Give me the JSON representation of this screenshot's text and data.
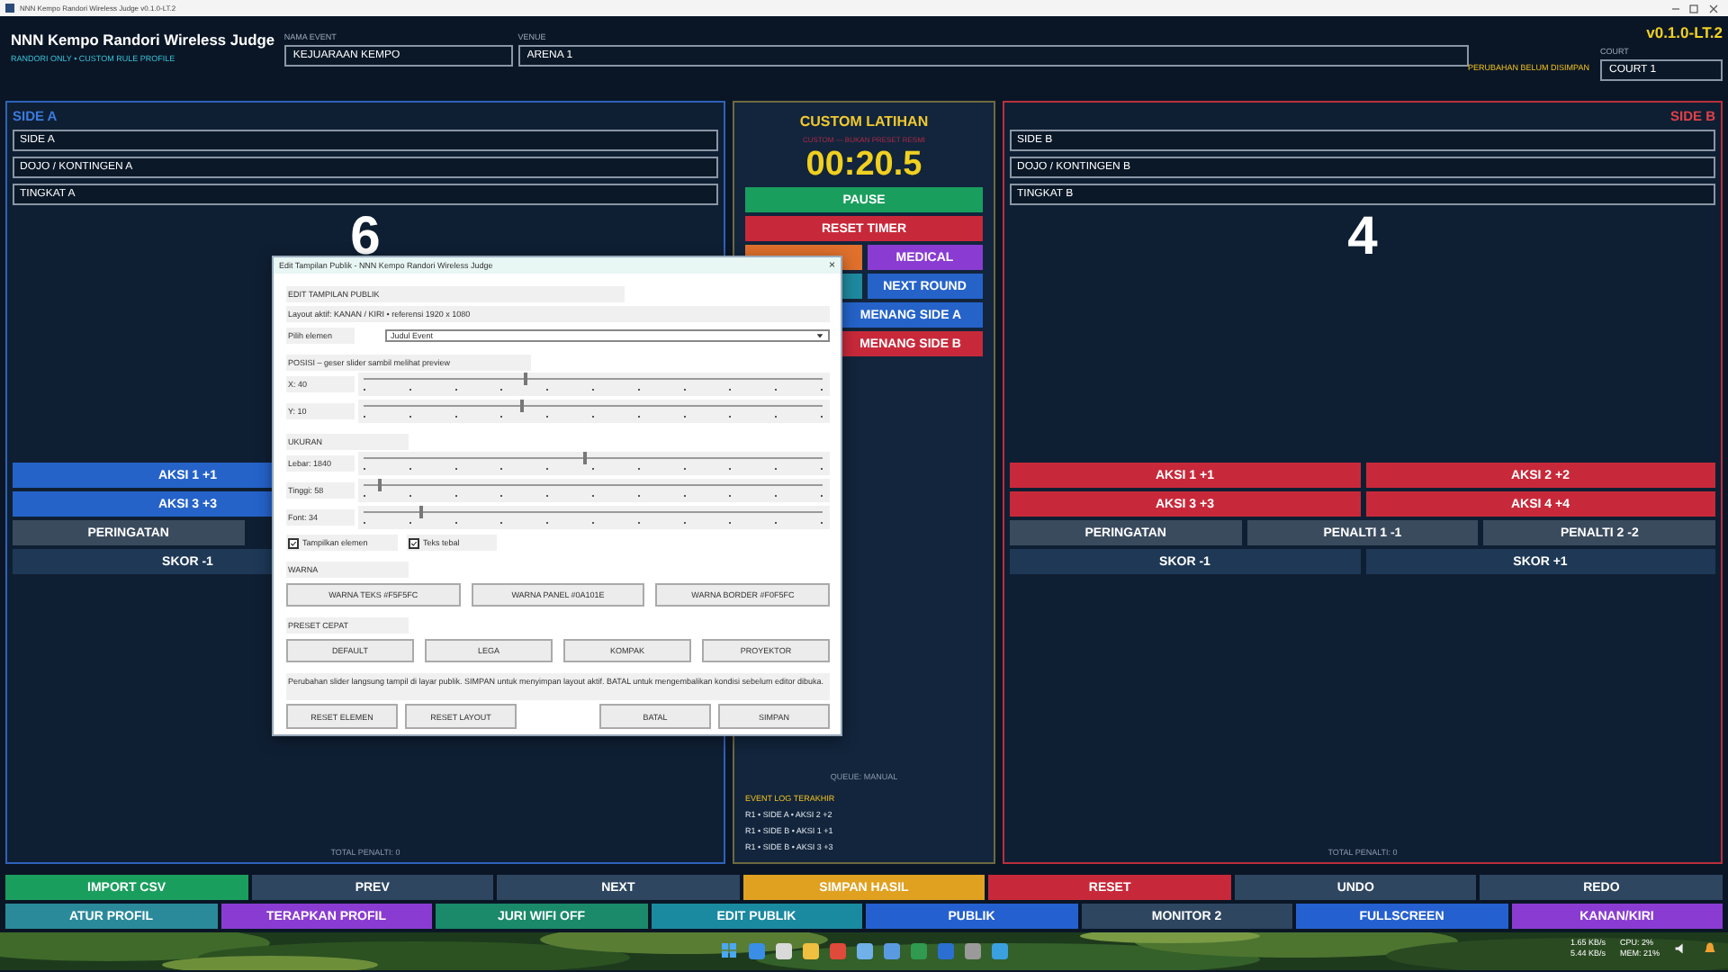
{
  "window": {
    "title": "NNN Kempo Randori Wireless Judge v0.1.0-LT.2"
  },
  "header": {
    "title": "NNN Kempo Randori Wireless Judge",
    "subtitle": "RANDORI ONLY • CUSTOM RULE PROFILE",
    "version": "v0.1.0-LT.2",
    "unsaved_notice": "PERUBAHAN BELUM DISIMPAN",
    "event_name": {
      "label": "NAMA EVENT",
      "value": "KEJUARAAN KEMPO"
    },
    "venue": {
      "label": "VENUE",
      "value": "ARENA 1"
    },
    "court": {
      "label": "COURT",
      "value": "COURT 1"
    }
  },
  "side_a": {
    "heading": "SIDE A",
    "fields": [
      "SIDE A",
      "DOJO / KONTINGEN A",
      "TINGKAT A"
    ],
    "score": "6",
    "button_rows": [
      {
        "kind": "aksi",
        "buttons": [
          {
            "label": "AKSI 1 +1",
            "color": "#2563c9"
          }
        ]
      },
      {
        "kind": "aksi",
        "buttons": [
          {
            "label": "AKSI 3 +3",
            "color": "#2563c9"
          }
        ]
      },
      {
        "kind": "penalti",
        "buttons": [
          {
            "label": "PERINGATAN",
            "color": "#3b4b5e"
          }
        ]
      },
      {
        "kind": "skor",
        "buttons": [
          {
            "label": "SKOR -1",
            "color": "#1e3856"
          }
        ]
      }
    ],
    "total": "TOTAL PENALTI: 0"
  },
  "side_b": {
    "heading": "SIDE B",
    "fields": [
      "SIDE B",
      "DOJO / KONTINGEN B",
      "TINGKAT B"
    ],
    "score": "4",
    "button_rows": [
      {
        "kind": "aksi",
        "buttons": [
          {
            "label": "AKSI 1 +1",
            "color": "#c8293a"
          },
          {
            "label": "AKSI 2 +2",
            "color": "#c8293a"
          }
        ]
      },
      {
        "kind": "aksi",
        "buttons": [
          {
            "label": "AKSI 3 +3",
            "color": "#c8293a"
          },
          {
            "label": "AKSI 4 +4",
            "color": "#c8293a"
          }
        ]
      },
      {
        "kind": "penalti",
        "buttons": [
          {
            "label": "PERINGATAN",
            "color": "#3b4b5e"
          },
          {
            "label": "PENALTI 1 -1",
            "color": "#3b4b5e"
          },
          {
            "label": "PENALTI 2 -2",
            "color": "#3b4b5e"
          }
        ]
      },
      {
        "kind": "skor",
        "buttons": [
          {
            "label": "SKOR -1",
            "color": "#1e3856"
          },
          {
            "label": "SKOR +1",
            "color": "#1e3856"
          }
        ]
      }
    ],
    "total": "TOTAL PENALTI: 0"
  },
  "center": {
    "mode": "CUSTOM LATIHAN",
    "mode_note": "CUSTOM — BUKAN PRESET RESMI",
    "timer": "00:20.5",
    "buttons": [
      {
        "kind": "full",
        "label": "PAUSE",
        "color": "#1a9e5e"
      },
      {
        "kind": "full",
        "label": "RESET TIMER",
        "color": "#c8293a"
      },
      {
        "kind": "half",
        "color": "#e0702c"
      },
      {
        "kind": "half",
        "label": "MEDICAL",
        "color": "#8a3cd2"
      },
      {
        "kind": "half",
        "color": "#1e8a9e"
      },
      {
        "kind": "half",
        "label": "NEXT ROUND",
        "color": "#2563c9"
      },
      {
        "kind": "full-right",
        "label": "MENANG SIDE A",
        "color": "#2563c9"
      },
      {
        "kind": "full-right",
        "label": "MENANG SIDE B",
        "color": "#c8293a"
      }
    ],
    "queue": "QUEUE: MANUAL",
    "log_title": "EVENT LOG TERAKHIR",
    "log": [
      "R1 • SIDE A • AKSI 2 +2",
      "R1 • SIDE B • AKSI 1 +1",
      "R1 • SIDE B • AKSI 3 +3"
    ]
  },
  "bottom_bar": [
    [
      {
        "label": "IMPORT CSV",
        "color": "#1a9e5e"
      },
      {
        "label": "PREV",
        "color": "#2e4660"
      },
      {
        "label": "NEXT",
        "color": "#2e4660"
      },
      {
        "label": "SIMPAN HASIL",
        "color": "#e0a020"
      },
      {
        "label": "RESET",
        "color": "#c8293a"
      },
      {
        "label": "UNDO",
        "color": "#2e4660"
      },
      {
        "label": "REDO",
        "color": "#2e4660"
      }
    ],
    [
      {
        "label": "ATUR PROFIL",
        "color": "#2a8a9a"
      },
      {
        "label": "TERAPKAN PROFIL",
        "color": "#8a3cd2"
      },
      {
        "label": "JURI WIFI OFF",
        "color": "#1a8a6a"
      },
      {
        "label": "EDIT PUBLIK",
        "color": "#1a8aa0"
      },
      {
        "label": "PUBLIK",
        "color": "#2560d0"
      },
      {
        "label": "MONITOR 2",
        "color": "#2e4660"
      },
      {
        "label": "FULLSCREEN",
        "color": "#2560d0"
      },
      {
        "label": "KANAN/KIRI",
        "color": "#8a3cd2"
      }
    ]
  ],
  "dialog": {
    "title": "Edit Tampilan Publik - NNN Kempo Randori Wireless Judge",
    "close": "×",
    "heading": "EDIT TAMPILAN PUBLIK",
    "layout_info": "Layout aktif: KANAN / KIRI • referensi 1920 x 1080",
    "element_label": "Pilih elemen",
    "element_value": "Judul Event",
    "position_heading": "POSISI – geser slider sambil melihat preview",
    "position_sliders": [
      {
        "label": "X: 40",
        "level": 0.35
      },
      {
        "label": "Y: 10",
        "level": 0.34
      }
    ],
    "size_heading": "UKURAN",
    "size_sliders": [
      {
        "label": "Lebar: 1840",
        "level": 0.48
      },
      {
        "label": "Tinggi: 58",
        "level": 0.03
      },
      {
        "label": "Font: 34",
        "level": 0.12
      }
    ],
    "checkboxes": [
      {
        "label": "Tampilkan elemen",
        "checked": true
      },
      {
        "label": "Teks tebal",
        "checked": true
      }
    ],
    "color_heading": "WARNA",
    "color_buttons": [
      "WARNA TEKS #F5F5FC",
      "WARNA PANEL #0A101E",
      "WARNA BORDER #F0F5FC"
    ],
    "preset_heading": "PRESET CEPAT",
    "preset_buttons": [
      "DEFAULT",
      "LEGA",
      "KOMPAK",
      "PROYEKTOR"
    ],
    "note": "Perubahan slider langsung tampil di layar publik. SIMPAN untuk menyimpan layout aktif. BATAL untuk mengembalikan kondisi sebelum editor dibuka.",
    "left_actions": [
      "RESET ELEMEN",
      "RESET LAYOUT"
    ],
    "right_actions": [
      "BATAL",
      "SIMPAN"
    ]
  },
  "taskbar": {
    "tray": [
      "1.65 KB/s",
      "5.44 KB/s",
      "CPU: 2%",
      "MEM: 21%"
    ]
  }
}
